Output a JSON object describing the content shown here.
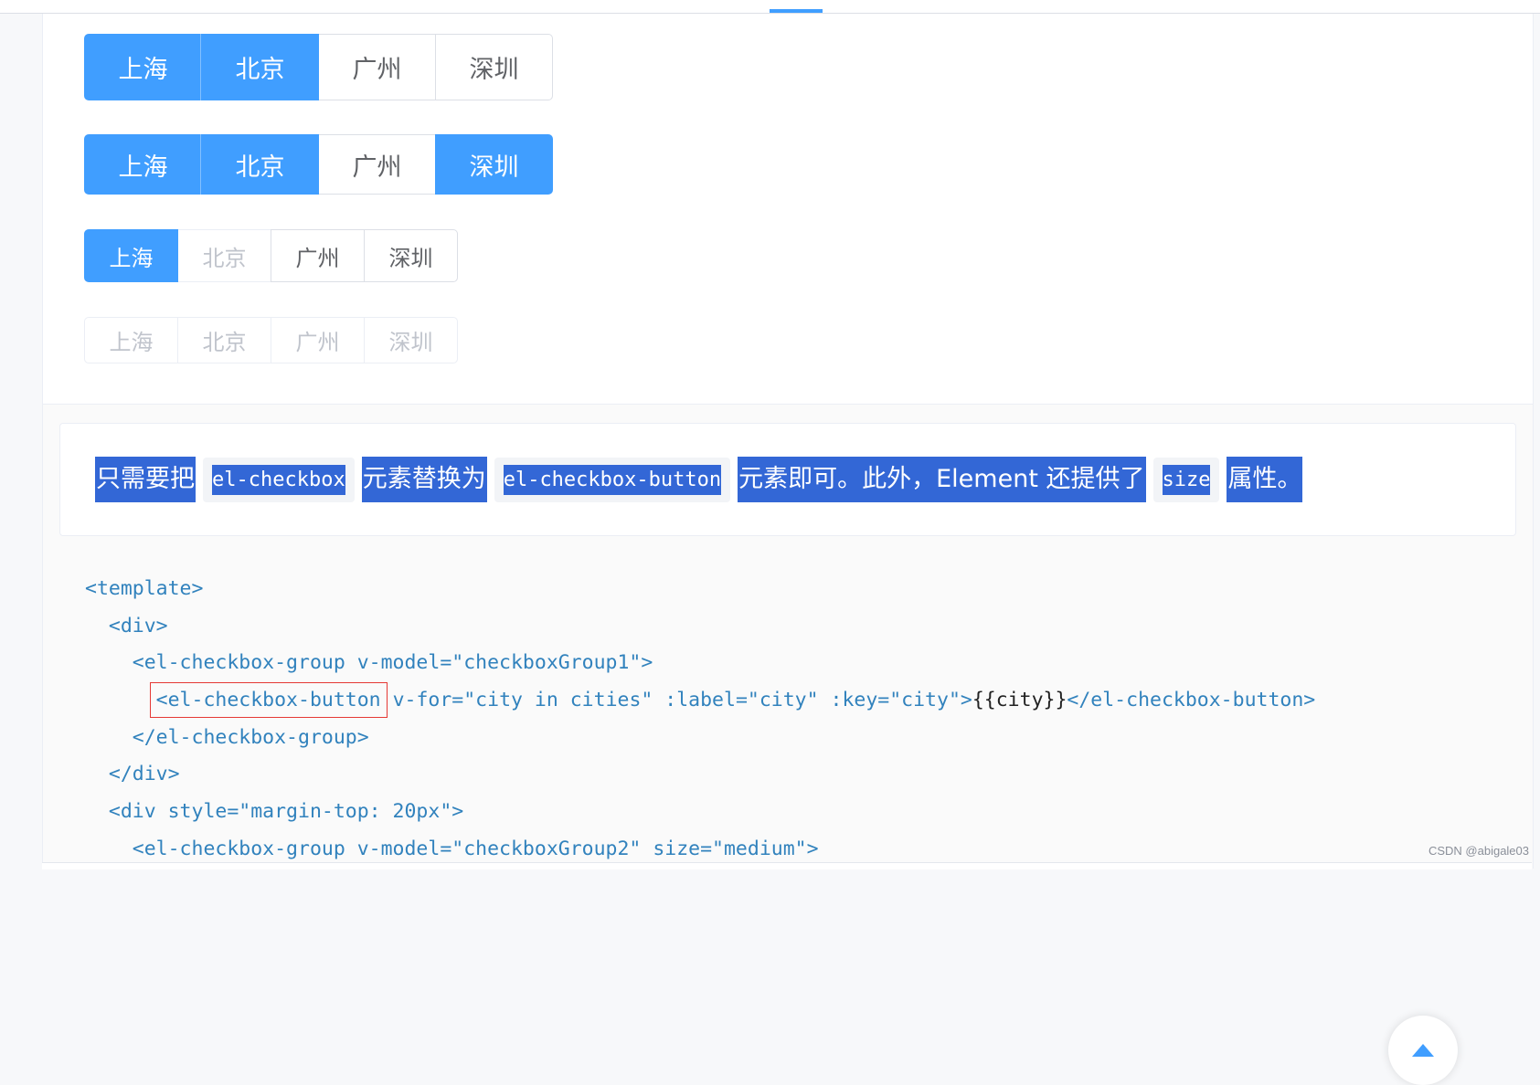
{
  "groups": [
    {
      "items": [
        {
          "label": "上海",
          "checked": true,
          "disabled": false
        },
        {
          "label": "北京",
          "checked": true,
          "disabled": false
        },
        {
          "label": "广州",
          "checked": false,
          "disabled": false
        },
        {
          "label": "深圳",
          "checked": false,
          "disabled": false
        }
      ]
    },
    {
      "items": [
        {
          "label": "上海",
          "checked": true,
          "disabled": false
        },
        {
          "label": "北京",
          "checked": true,
          "disabled": false
        },
        {
          "label": "广州",
          "checked": false,
          "disabled": false
        },
        {
          "label": "深圳",
          "checked": true,
          "disabled": false
        }
      ]
    },
    {
      "items": [
        {
          "label": "上海",
          "checked": true,
          "disabled": false
        },
        {
          "label": "北京",
          "checked": false,
          "disabled": true
        },
        {
          "label": "广州",
          "checked": false,
          "disabled": false
        },
        {
          "label": "深圳",
          "checked": false,
          "disabled": false
        }
      ]
    },
    {
      "items": [
        {
          "label": "上海",
          "checked": false,
          "disabled": true
        },
        {
          "label": "北京",
          "checked": false,
          "disabled": true
        },
        {
          "label": "广州",
          "checked": false,
          "disabled": true
        },
        {
          "label": "深圳",
          "checked": false,
          "disabled": true
        }
      ]
    }
  ],
  "description": {
    "part1": "只需要把",
    "code1": "el-checkbox",
    "part2": "元素替换为",
    "code2": "el-checkbox-button",
    "part3": "元素即可。此外，Element 还提供了",
    "code3": "size",
    "part4": "属性。"
  },
  "code": {
    "line1": "<template>",
    "line2": "  <div>",
    "line3": "    <el-checkbox-group v-model=\"checkboxGroup1\">",
    "line4a": "<el-checkbox-button",
    "line4b": " v-for=\"city in cities\" :label=\"city\" :key=\"city\">",
    "line4c": "{{city}}",
    "line4d": "</el-checkbox-button>",
    "line5": "    </el-checkbox-group>",
    "line6": "  </div>",
    "line7": "  <div style=\"margin-top: 20px\">",
    "line8": "    <el-checkbox-group v-model=\"checkboxGroup2\" size=\"medium\">"
  },
  "watermark": "CSDN @abigale03",
  "colors": {
    "primary": "#409eff",
    "selection": "#3367d6",
    "highlight_box": "#e53935"
  }
}
